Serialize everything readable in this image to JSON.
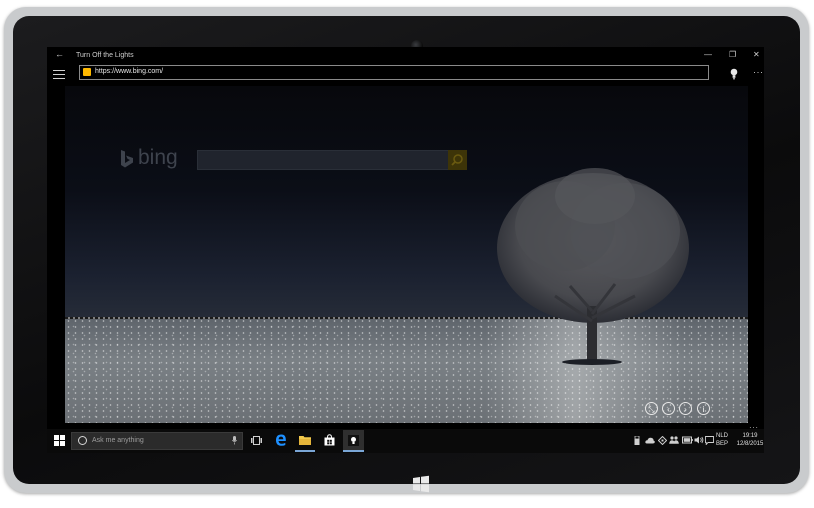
{
  "window": {
    "title": "Turn Off the Lights",
    "back_glyph": "←",
    "minimize_glyph": "—",
    "restore_glyph": "❐",
    "close_glyph": "✕"
  },
  "browser": {
    "url": "https://www.bing.com/",
    "more_glyph": "···"
  },
  "page": {
    "brand_word": "bing",
    "controls": [
      {
        "name": "shrink-icon",
        "glyph": "⤡"
      },
      {
        "name": "previous-icon",
        "glyph": "‹"
      },
      {
        "name": "next-icon",
        "glyph": "›"
      },
      {
        "name": "info-icon",
        "glyph": "i"
      }
    ]
  },
  "taskbar": {
    "search_placeholder": "Ask me anything",
    "overflow_glyph": "···",
    "language": {
      "line1": "NLD",
      "line2": "BEP"
    },
    "clock": {
      "time": "19:19",
      "date": "12/8/2015"
    }
  },
  "colors": {
    "accent": "#ffb900",
    "edge_blue": "#1e90ff",
    "taskbar_bg": "#0a0a0a"
  }
}
